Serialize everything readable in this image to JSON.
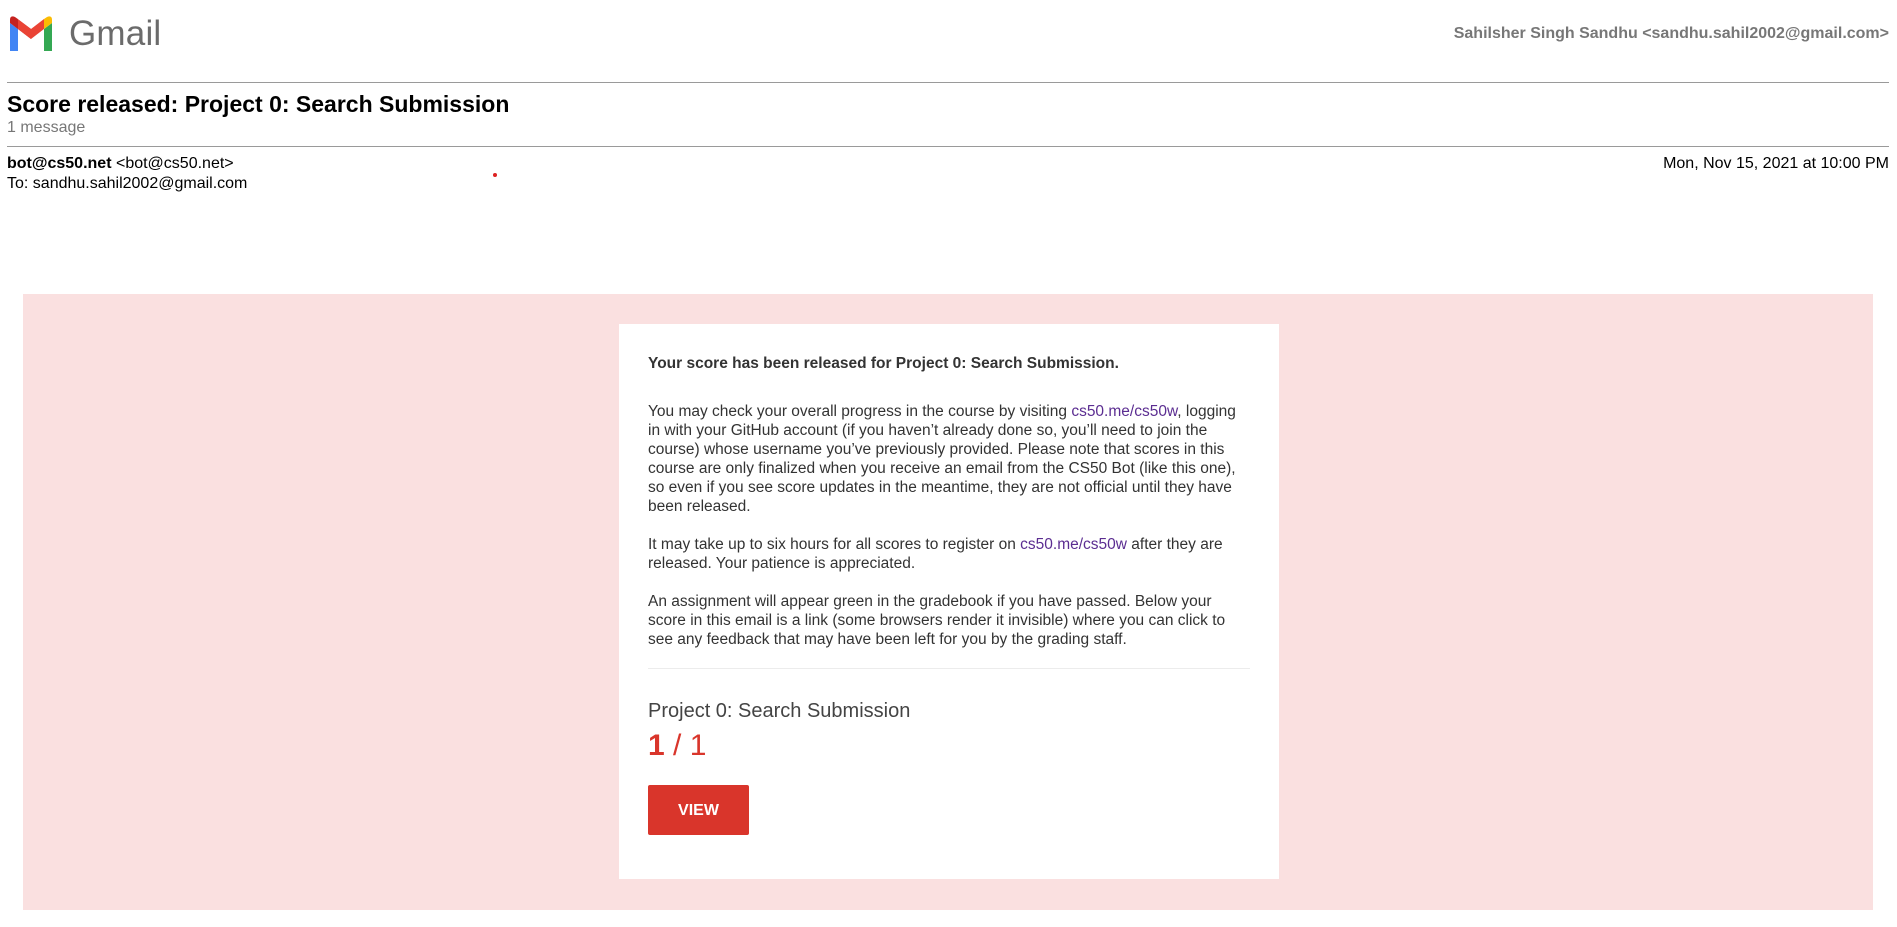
{
  "header": {
    "app_name": "Gmail",
    "account": "Sahilsher Singh Sandhu <sandhu.sahil2002@gmail.com>"
  },
  "email": {
    "subject": "Score released: Project 0: Search Submission",
    "message_count": "1 message",
    "sender_name": "bot@cs50.net",
    "sender_address": "<bot@cs50.net>",
    "to": "To: sandhu.sahil2002@gmail.com",
    "date": "Mon, Nov 15, 2021 at 10:00 PM"
  },
  "body": {
    "lead": "Your score has been released for Project 0: Search Submission.",
    "p1_pre": "You may check your overall progress in the course by visiting ",
    "p1_link": "cs50.me/cs50w",
    "p1_post": ", logging in with your GitHub account (if you haven’t already done so, you’ll need to join the course) whose username you’ve previously provided. Please note that scores in this course are only finalized when you receive an email from the CS50 Bot (like this one), so even if you see score updates in the meantime, they are not official until they have been released.",
    "p2_pre": "It may take up to six hours for all scores to register on ",
    "p2_link": "cs50.me/cs50w",
    "p2_post": " after they are released. Your patience is appreciated.",
    "p3": "An assignment will appear green in the gradebook if you have passed. Below your score in this email is a link (some browsers render it invisible) where you can click to see any feedback that may have been left for you by the grading staff.",
    "project_name": "Project 0: Search Submission",
    "score_earned": "1",
    "score_total": " / 1",
    "view_label": "VIEW"
  },
  "colors": {
    "accent": "#d9352b",
    "background_band": "#fae0e0",
    "link": "#5b2d91"
  }
}
